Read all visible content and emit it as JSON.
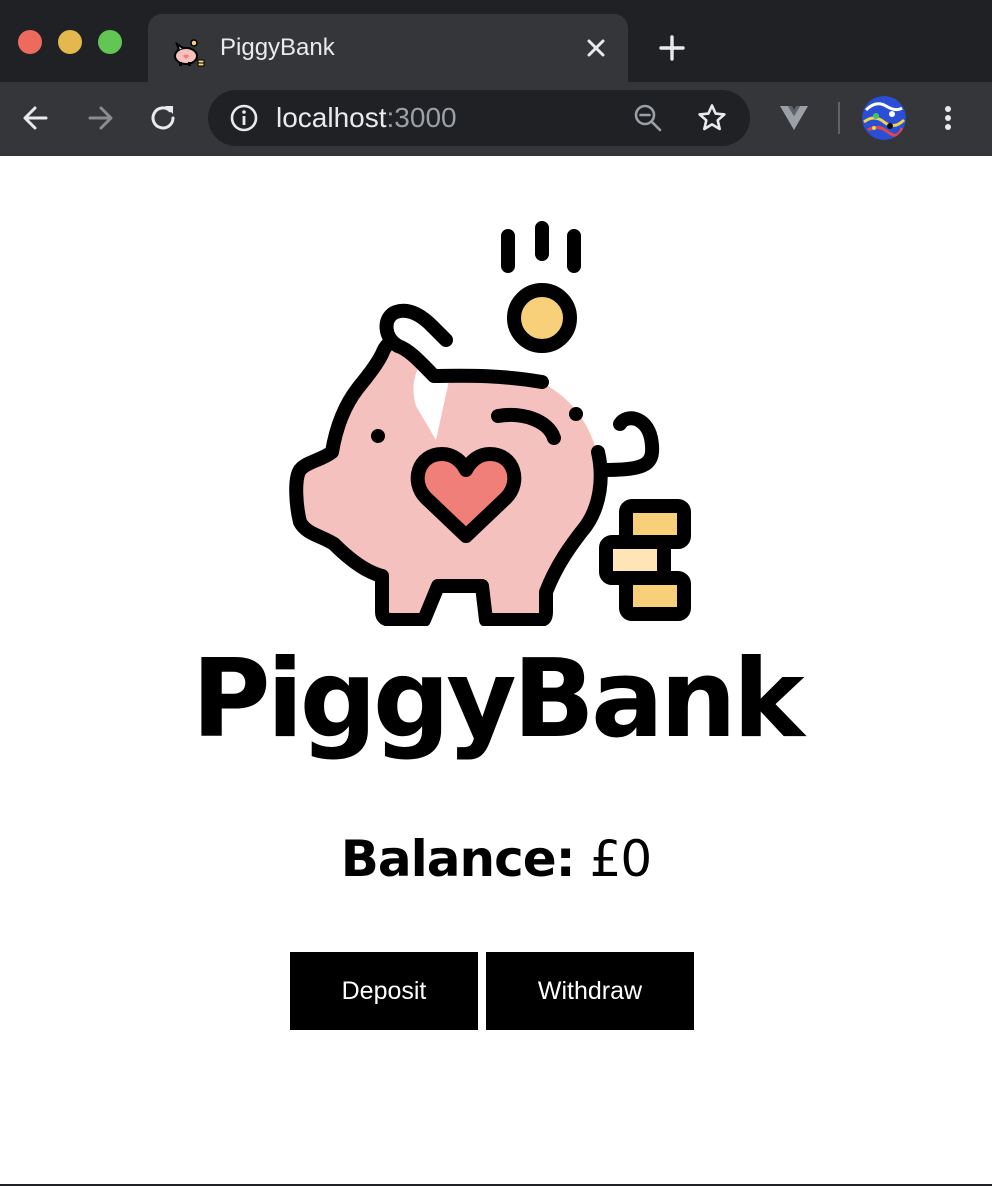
{
  "browser": {
    "tab": {
      "title": "PiggyBank",
      "favicon": "piggy-bank-icon"
    },
    "address_bar": {
      "host": "localhost",
      "port": ":3000"
    },
    "icons": [
      "back-icon",
      "forward-icon",
      "reload-icon",
      "info-icon",
      "zoom-out-icon",
      "star-icon",
      "vue-devtools-icon",
      "menu-icon"
    ]
  },
  "app": {
    "logo": "piggy-bank-icon",
    "title": "PiggyBank",
    "balance": {
      "label": "Balance:",
      "value": "£0"
    },
    "actions": {
      "deposit_label": "Deposit",
      "withdraw_label": "Withdraw"
    }
  },
  "colors": {
    "pig_body": "#f5c1be",
    "heart": "#ef7f78",
    "coin": "#f8d07a",
    "coin_light": "#fde5b6",
    "button_bg": "#000000",
    "button_text": "#ffffff"
  }
}
